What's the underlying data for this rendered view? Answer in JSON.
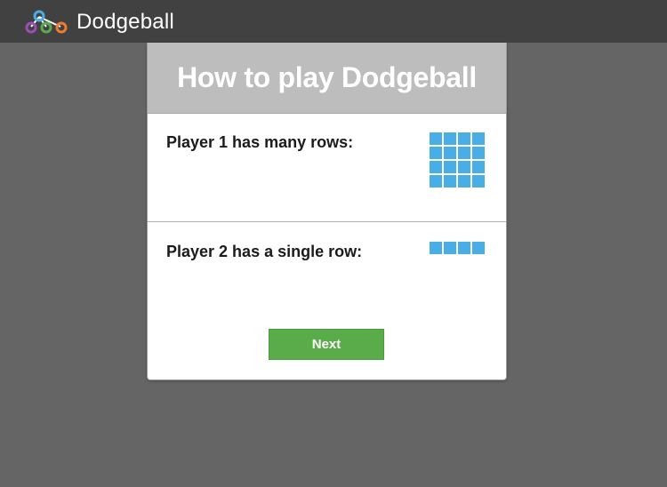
{
  "app": {
    "title": "Dodgeball",
    "logo_icon": "dodgeball-logo-icon",
    "logo_colors": [
      "#4aaee6",
      "#9b4fb5",
      "#5aac4a",
      "#f07b2e"
    ]
  },
  "dialog": {
    "title": "How to play Dodgeball",
    "sections": [
      {
        "label": "Player 1 has many rows:",
        "grid_rows": 4,
        "grid_cols": 4
      },
      {
        "label": "Player 2 has a single row:",
        "grid_rows": 1,
        "grid_cols": 4
      }
    ],
    "next_label": "Next"
  },
  "colors": {
    "background": "#656565",
    "topbar": "#414141",
    "header": "#bdbdbd",
    "cell": "#4aaee6",
    "button": "#5aac4a"
  }
}
